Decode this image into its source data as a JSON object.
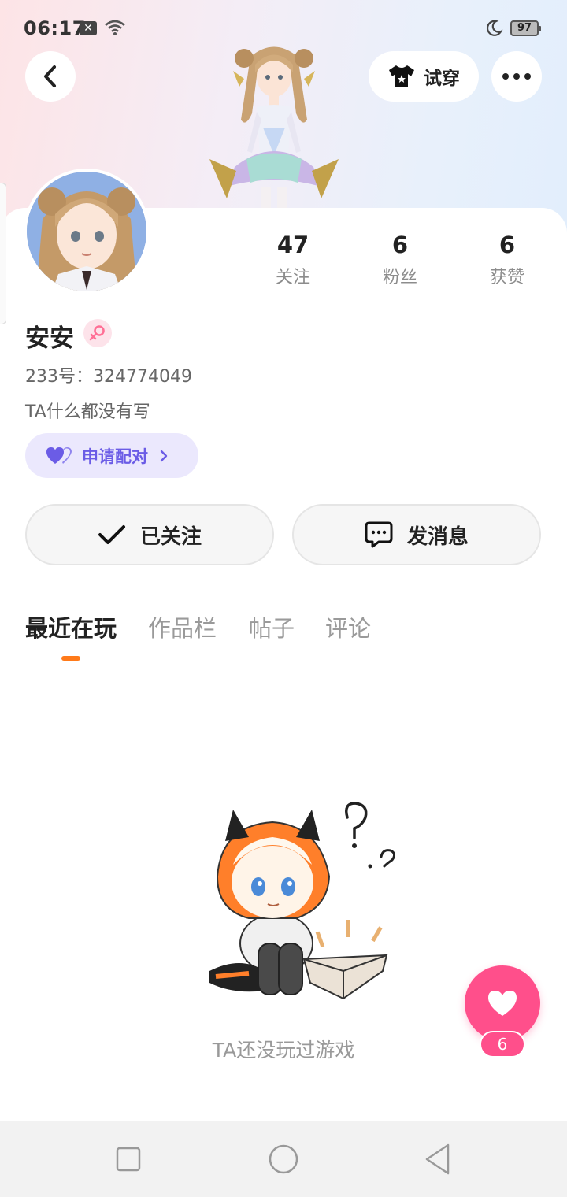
{
  "status_bar": {
    "time": "06:17",
    "notification_icon": "close-box-icon",
    "battery": "97"
  },
  "header": {
    "back_icon": "chevron-left-icon",
    "tryon_label": "试穿",
    "more_icon": "more-horizontal-icon"
  },
  "profile": {
    "nickname": "安安",
    "gender": "female",
    "user_id": "233号：324774049",
    "bio": "TA什么都没有写",
    "match_label": "申请配对",
    "stats": [
      {
        "value": "47",
        "label": "关注"
      },
      {
        "value": "6",
        "label": "粉丝"
      },
      {
        "value": "6",
        "label": "获赞"
      }
    ]
  },
  "actions": {
    "follow_label": "已关注",
    "message_label": "发消息"
  },
  "tabs": [
    {
      "label": "最近在玩",
      "active": true
    },
    {
      "label": "作品栏",
      "active": false
    },
    {
      "label": "帖子",
      "active": false
    },
    {
      "label": "评论",
      "active": false
    }
  ],
  "empty_state": {
    "text": "TA还没玩过游戏"
  },
  "like": {
    "count": "6"
  },
  "colors": {
    "accent_orange": "#ff7a1a",
    "match_purple": "#6b5ce6",
    "like_pink": "#ff4f8b"
  }
}
